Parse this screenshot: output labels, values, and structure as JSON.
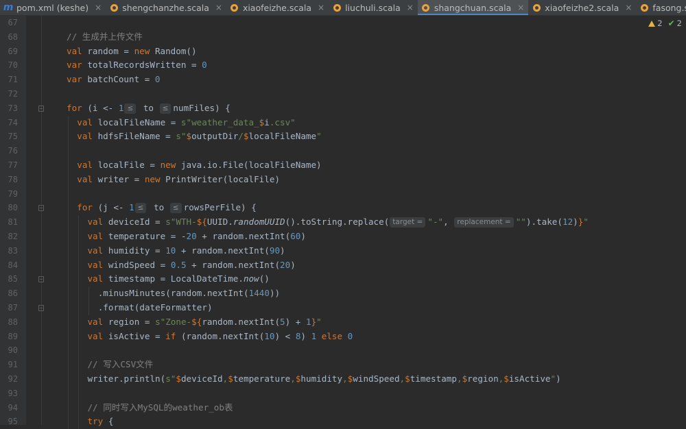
{
  "tabs": [
    {
      "label": "pom.xml (keshe)",
      "icon": "maven-m-icon",
      "active": false
    },
    {
      "label": "shengchanzhe.scala",
      "icon": "scala-file-icon",
      "active": false
    },
    {
      "label": "xiaofeizhe.scala",
      "icon": "scala-file-icon",
      "active": false
    },
    {
      "label": "liuchuli.scala",
      "icon": "scala-file-icon",
      "active": false
    },
    {
      "label": "shangchuan.scala",
      "icon": "scala-file-icon",
      "active": true
    },
    {
      "label": "xiaofeizhe2.scala",
      "icon": "scala-file-icon",
      "active": false
    },
    {
      "label": "fasong.scala",
      "icon": "scala-file-icon",
      "active": false
    }
  ],
  "close_glyph": "×",
  "inspections": {
    "warnings": "2",
    "weak_warnings": "2"
  },
  "colors": {
    "keyword": "#cc7832",
    "number": "#6897bb",
    "string": "#6a8759",
    "comment": "#808080",
    "text": "#a9b7c6",
    "accent": "#4a88c7"
  },
  "lines": [
    {
      "n": "67",
      "indent": 0,
      "tokens": []
    },
    {
      "n": "68",
      "indent": 0,
      "tokens": [
        [
          "c",
          "// 生成并上传文件"
        ]
      ]
    },
    {
      "n": "69",
      "indent": 0,
      "tokens": [
        [
          "k",
          "val "
        ],
        [
          "p",
          "random = "
        ],
        [
          "k",
          "new "
        ],
        [
          "p",
          "Random()"
        ]
      ]
    },
    {
      "n": "70",
      "indent": 0,
      "tokens": [
        [
          "k",
          "var "
        ],
        [
          "p",
          "totalRecordsWritten = "
        ],
        [
          "n",
          "0"
        ]
      ]
    },
    {
      "n": "71",
      "indent": 0,
      "tokens": [
        [
          "k",
          "var "
        ],
        [
          "p",
          "batchCount = "
        ],
        [
          "n",
          "0"
        ]
      ]
    },
    {
      "n": "72",
      "indent": 0,
      "tokens": []
    },
    {
      "n": "73",
      "indent": 0,
      "fold": true,
      "tokens": [
        [
          "k",
          "for "
        ],
        [
          "p",
          "(i <- "
        ],
        [
          "n",
          "1"
        ],
        [
          "h",
          "≤"
        ],
        [
          "p",
          " to "
        ],
        [
          "h",
          "≤"
        ],
        [
          "p",
          "numFiles) {"
        ]
      ]
    },
    {
      "n": "74",
      "indent": 1,
      "tokens": [
        [
          "k",
          "val "
        ],
        [
          "p",
          "localFileName = "
        ],
        [
          "s",
          "s\"weather_data_"
        ],
        [
          "k",
          "$"
        ],
        [
          "p",
          "i"
        ],
        [
          "s",
          ".csv\""
        ]
      ]
    },
    {
      "n": "75",
      "indent": 1,
      "tokens": [
        [
          "k",
          "val "
        ],
        [
          "p",
          "hdfsFileName = "
        ],
        [
          "s",
          "s\""
        ],
        [
          "k",
          "$"
        ],
        [
          "p",
          "outputDir"
        ],
        [
          "s",
          "/"
        ],
        [
          "k",
          "$"
        ],
        [
          "p",
          "localFileName"
        ],
        [
          "s",
          "\""
        ]
      ]
    },
    {
      "n": "76",
      "indent": 1,
      "tokens": []
    },
    {
      "n": "77",
      "indent": 1,
      "tokens": [
        [
          "k",
          "val "
        ],
        [
          "p",
          "localFile = "
        ],
        [
          "k",
          "new "
        ],
        [
          "p",
          "java.io.File(localFileName)"
        ]
      ]
    },
    {
      "n": "78",
      "indent": 1,
      "tokens": [
        [
          "k",
          "val "
        ],
        [
          "p",
          "writer = "
        ],
        [
          "k",
          "new "
        ],
        [
          "p",
          "PrintWriter(localFile)"
        ]
      ]
    },
    {
      "n": "79",
      "indent": 1,
      "tokens": []
    },
    {
      "n": "80",
      "indent": 1,
      "fold": true,
      "tokens": [
        [
          "k",
          "for "
        ],
        [
          "p",
          "(j <- "
        ],
        [
          "n",
          "1"
        ],
        [
          "h",
          "≤"
        ],
        [
          "p",
          " to "
        ],
        [
          "h",
          "≤"
        ],
        [
          "p",
          "rowsPerFile) {"
        ]
      ]
    },
    {
      "n": "81",
      "indent": 2,
      "tokens": [
        [
          "k",
          "val "
        ],
        [
          "p",
          "deviceId = "
        ],
        [
          "s",
          "s\"WTH-"
        ],
        [
          "k",
          "${"
        ],
        [
          "p",
          "UUID."
        ],
        [
          "i",
          "randomUUID"
        ],
        [
          "p",
          "().toString.replace("
        ],
        [
          "h",
          "target ="
        ],
        [
          "s",
          "\"-\""
        ],
        [
          "p",
          ", "
        ],
        [
          "h",
          "replacement ="
        ],
        [
          "s",
          "\"\""
        ],
        [
          "p",
          ").take("
        ],
        [
          "n",
          "12"
        ],
        [
          "p",
          ")"
        ],
        [
          "k",
          "}"
        ],
        [
          "s",
          "\""
        ]
      ]
    },
    {
      "n": "82",
      "indent": 2,
      "tokens": [
        [
          "k",
          "val "
        ],
        [
          "p",
          "temperature = -"
        ],
        [
          "n",
          "20"
        ],
        [
          "p",
          " + random.nextInt("
        ],
        [
          "n",
          "60"
        ],
        [
          "p",
          ")"
        ]
      ]
    },
    {
      "n": "83",
      "indent": 2,
      "tokens": [
        [
          "k",
          "val "
        ],
        [
          "p",
          "humidity = "
        ],
        [
          "n",
          "10"
        ],
        [
          "p",
          " + random.nextInt("
        ],
        [
          "n",
          "90"
        ],
        [
          "p",
          ")"
        ]
      ]
    },
    {
      "n": "84",
      "indent": 2,
      "tokens": [
        [
          "k",
          "val "
        ],
        [
          "p",
          "windSpeed = "
        ],
        [
          "n",
          "0.5"
        ],
        [
          "p",
          " + random.nextInt("
        ],
        [
          "n",
          "20"
        ],
        [
          "p",
          ")"
        ]
      ]
    },
    {
      "n": "85",
      "indent": 2,
      "fold": true,
      "tokens": [
        [
          "k",
          "val "
        ],
        [
          "p",
          "timestamp = LocalDateTime."
        ],
        [
          "i",
          "now"
        ],
        [
          "p",
          "()"
        ]
      ]
    },
    {
      "n": "86",
      "indent": 3,
      "tokens": [
        [
          "p",
          ".minusMinutes(random.nextInt("
        ],
        [
          "n",
          "1440"
        ],
        [
          "p",
          "))"
        ]
      ]
    },
    {
      "n": "87",
      "indent": 3,
      "fold": true,
      "tokens": [
        [
          "p",
          ".format(dateFormatter)"
        ]
      ]
    },
    {
      "n": "88",
      "indent": 2,
      "tokens": [
        [
          "k",
          "val "
        ],
        [
          "p",
          "region = "
        ],
        [
          "s",
          "s\"Zone-"
        ],
        [
          "k",
          "${"
        ],
        [
          "p",
          "random.nextInt("
        ],
        [
          "n",
          "5"
        ],
        [
          "p",
          ") + "
        ],
        [
          "n",
          "1"
        ],
        [
          "k",
          "}"
        ],
        [
          "s",
          "\""
        ]
      ]
    },
    {
      "n": "89",
      "indent": 2,
      "tokens": [
        [
          "k",
          "val "
        ],
        [
          "p",
          "isActive = "
        ],
        [
          "k",
          "if "
        ],
        [
          "p",
          "(random.nextInt("
        ],
        [
          "n",
          "10"
        ],
        [
          "p",
          ") < "
        ],
        [
          "n",
          "8"
        ],
        [
          "p",
          ") "
        ],
        [
          "n",
          "1"
        ],
        [
          "k",
          " else "
        ],
        [
          "n",
          "0"
        ]
      ]
    },
    {
      "n": "90",
      "indent": 2,
      "tokens": []
    },
    {
      "n": "91",
      "indent": 2,
      "tokens": [
        [
          "c",
          "// 写入CSV文件"
        ]
      ]
    },
    {
      "n": "92",
      "indent": 2,
      "tokens": [
        [
          "p",
          "writer.println("
        ],
        [
          "s",
          "s\""
        ],
        [
          "k",
          "$"
        ],
        [
          "p",
          "deviceId"
        ],
        [
          "s",
          ","
        ],
        [
          "k",
          "$"
        ],
        [
          "p",
          "temperature"
        ],
        [
          "s",
          ","
        ],
        [
          "k",
          "$"
        ],
        [
          "p",
          "humidity"
        ],
        [
          "s",
          ","
        ],
        [
          "k",
          "$"
        ],
        [
          "p",
          "windSpeed"
        ],
        [
          "s",
          ","
        ],
        [
          "k",
          "$"
        ],
        [
          "p",
          "timestamp"
        ],
        [
          "s",
          ","
        ],
        [
          "k",
          "$"
        ],
        [
          "p",
          "region"
        ],
        [
          "s",
          ","
        ],
        [
          "k",
          "$"
        ],
        [
          "p",
          "isActive"
        ],
        [
          "s",
          "\""
        ],
        [
          "p",
          ")"
        ]
      ]
    },
    {
      "n": "93",
      "indent": 2,
      "tokens": []
    },
    {
      "n": "94",
      "indent": 2,
      "tokens": [
        [
          "c",
          "// 同时写入MySQL的weather_ob表"
        ]
      ]
    },
    {
      "n": "95",
      "indent": 2,
      "tokens": [
        [
          "k",
          "try "
        ],
        [
          "p",
          "{"
        ]
      ]
    }
  ]
}
